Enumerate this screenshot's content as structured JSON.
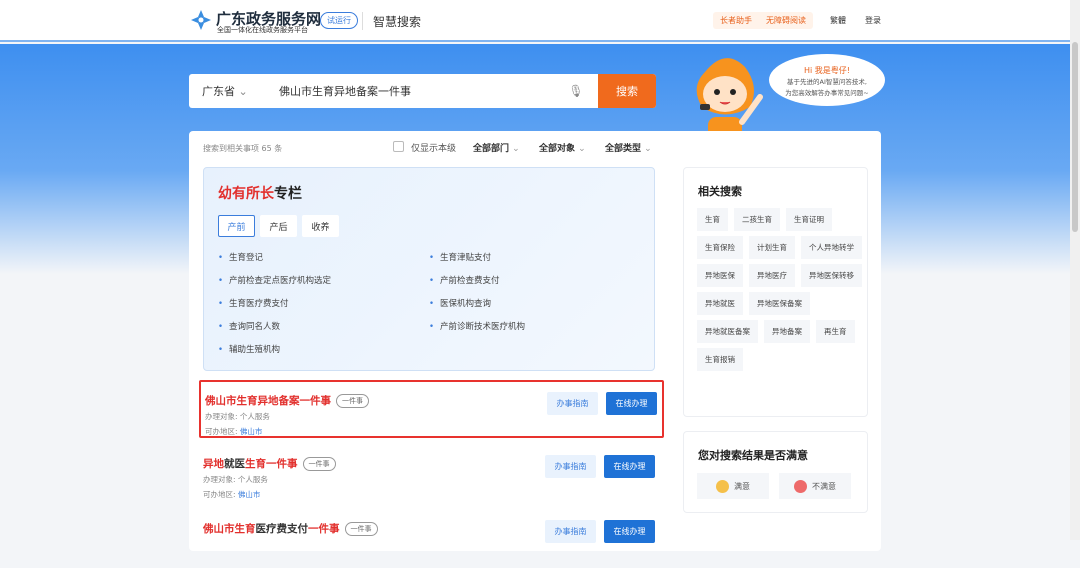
{
  "header": {
    "brand": "广东政务服务网",
    "brand_sub": "全国一体化在线政务服务平台",
    "trial": "试运行",
    "section": "智慧搜索",
    "elder": "长者助手",
    "accessible": "无障碍阅读",
    "traditional": "繁體",
    "login": "登录"
  },
  "search": {
    "province": "广东省",
    "query": "佛山市生育异地备案一件事",
    "button": "搜索"
  },
  "mascot": {
    "greeting": "Hi 我是粤仔!",
    "line1": "基于先进的AI智慧问答技术,",
    "line2": "为您高效解答办事常见问题~"
  },
  "filters": {
    "count": "搜索到相关事项 65 条",
    "local_only": "仅显示本级",
    "dept": "全部部门",
    "target": "全部对象",
    "type": "全部类型"
  },
  "column": {
    "title_red": "幼有所长",
    "title_rest": "专栏",
    "tabs": [
      "产前",
      "产后",
      "收养"
    ],
    "links": [
      "生育登记",
      "生育津贴支付",
      "产前检查定点医疗机构选定",
      "产前检查费支付",
      "生育医疗费支付",
      "医保机构查询",
      "查询同名人数",
      "产前诊断技术医疗机构",
      "辅助生殖机构"
    ]
  },
  "results": [
    {
      "title": [
        [
          "佛山市生育异地备案一件事",
          true
        ]
      ],
      "tag": "一件事",
      "target_label": "办理对象:",
      "target": "个人服务",
      "area_label": "可办地区:",
      "area": "佛山市",
      "guide": "办事指南",
      "online": "在线办理"
    },
    {
      "title": [
        [
          "异地",
          true
        ],
        [
          "就医",
          false
        ],
        [
          "生育一件事",
          true
        ]
      ],
      "tag": "一件事",
      "target_label": "办理对象:",
      "target": "个人服务",
      "area_label": "可办地区:",
      "area": "佛山市",
      "guide": "办事指南",
      "online": "在线办理"
    },
    {
      "title": [
        [
          "佛山市生育",
          true
        ],
        [
          "医疗费支付",
          false
        ],
        [
          "一件事",
          true
        ]
      ],
      "tag": "一件事",
      "guide": "办事指南",
      "online": "在线办理"
    }
  ],
  "related": {
    "title": "相关搜索",
    "chips": [
      "生育",
      "二孩生育",
      "生育证明",
      "生育保险",
      "计划生育",
      "个人异地转学",
      "异地医保",
      "异地医疗",
      "异地医保转移",
      "异地就医",
      "异地医保备案",
      "异地就医备案",
      "异地备案",
      "再生育",
      "生育报销"
    ]
  },
  "feedback": {
    "title": "您对搜索结果是否满意",
    "yes": "满意",
    "no": "不满意"
  },
  "colors": {
    "brand_blue": "#1f72d6",
    "accent_orange": "#f06a1d",
    "highlight_red": "#e2302d"
  }
}
